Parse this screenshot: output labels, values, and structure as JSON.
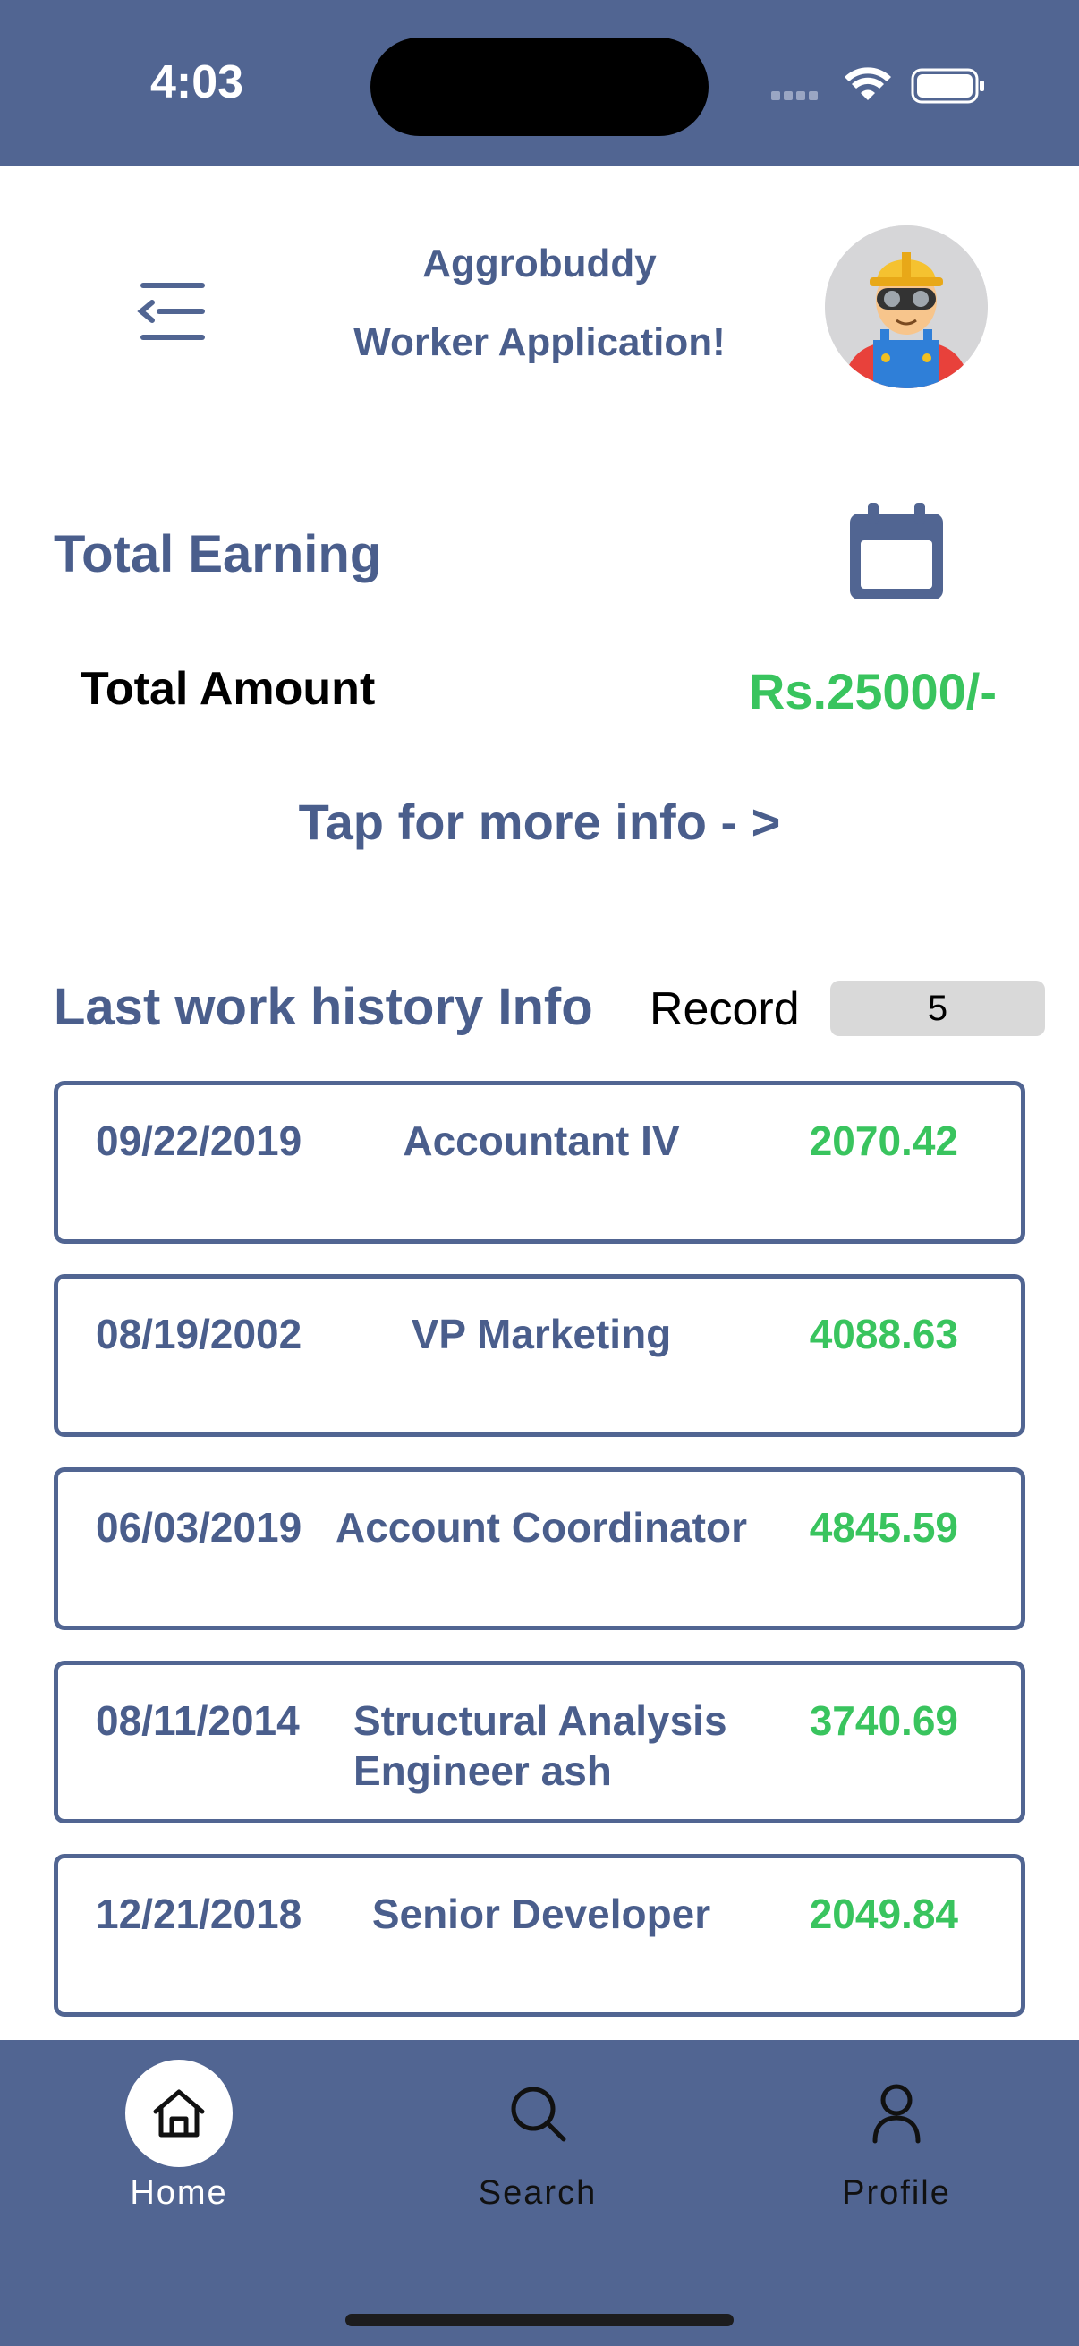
{
  "status_bar": {
    "time": "4:03"
  },
  "header": {
    "title_line1": "Aggrobuddy",
    "title_line2": "Worker Application!",
    "menu_icon": "menu-icon",
    "avatar_icon": "worker-avatar-icon"
  },
  "earnings": {
    "title": "Total Earning",
    "amount_label": "Total Amount",
    "amount_value": "Rs.25000/-",
    "more_info": "Tap for more info - >",
    "calendar_icon": "calendar-icon"
  },
  "history": {
    "title": "Last work history Info",
    "record_label": "Record",
    "record_count": "5",
    "rows": [
      {
        "date": "09/22/2019",
        "title": "Accountant IV",
        "amount": "2070.42"
      },
      {
        "date": "08/19/2002",
        "title": "VP Marketing",
        "amount": "4088.63"
      },
      {
        "date": "06/03/2019",
        "title": "Account Coordinator",
        "amount": "4845.59"
      },
      {
        "date": "08/11/2014",
        "title": "Structural Analysis Engineer ash",
        "amount": "3740.69"
      },
      {
        "date": "12/21/2018",
        "title": "Senior Developer",
        "amount": "2049.84"
      }
    ]
  },
  "tabs": [
    {
      "label": "Home",
      "icon": "home-icon",
      "active": true
    },
    {
      "label": "Search",
      "icon": "search-icon",
      "active": false
    },
    {
      "label": "Profile",
      "icon": "profile-icon",
      "active": false
    }
  ],
  "colors": {
    "primary": "#516592",
    "text_primary": "#4a5e8c",
    "amount_green": "#39c45e"
  }
}
